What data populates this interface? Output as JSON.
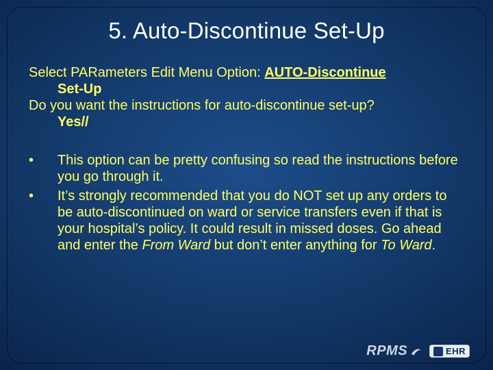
{
  "title": "5. Auto-Discontinue Set-Up",
  "prompt": {
    "line1_pre": "Select PARameters Edit Menu Option: ",
    "line1_bold": "AUTO-Discontinue",
    "line1_bold2": "Set-Up",
    "line2": "Do you want the instructions for auto-discontinue set-up?",
    "line2_answer": "Yes//"
  },
  "bullets": [
    {
      "text": "This option can be pretty confusing so read the instructions before you go through it."
    },
    {
      "pre": "It’s strongly recommended that you do NOT set up any orders to be auto-discontinued on ward or service transfers even if that is your hospital’s policy. It could result in missed doses. Go ahead and enter the ",
      "em1": "From Ward",
      "mid": " but don’t enter anything for ",
      "em2": "To Ward",
      "post": "."
    }
  ],
  "logos": {
    "rpms": "RPMS",
    "ehr": "EHR"
  }
}
